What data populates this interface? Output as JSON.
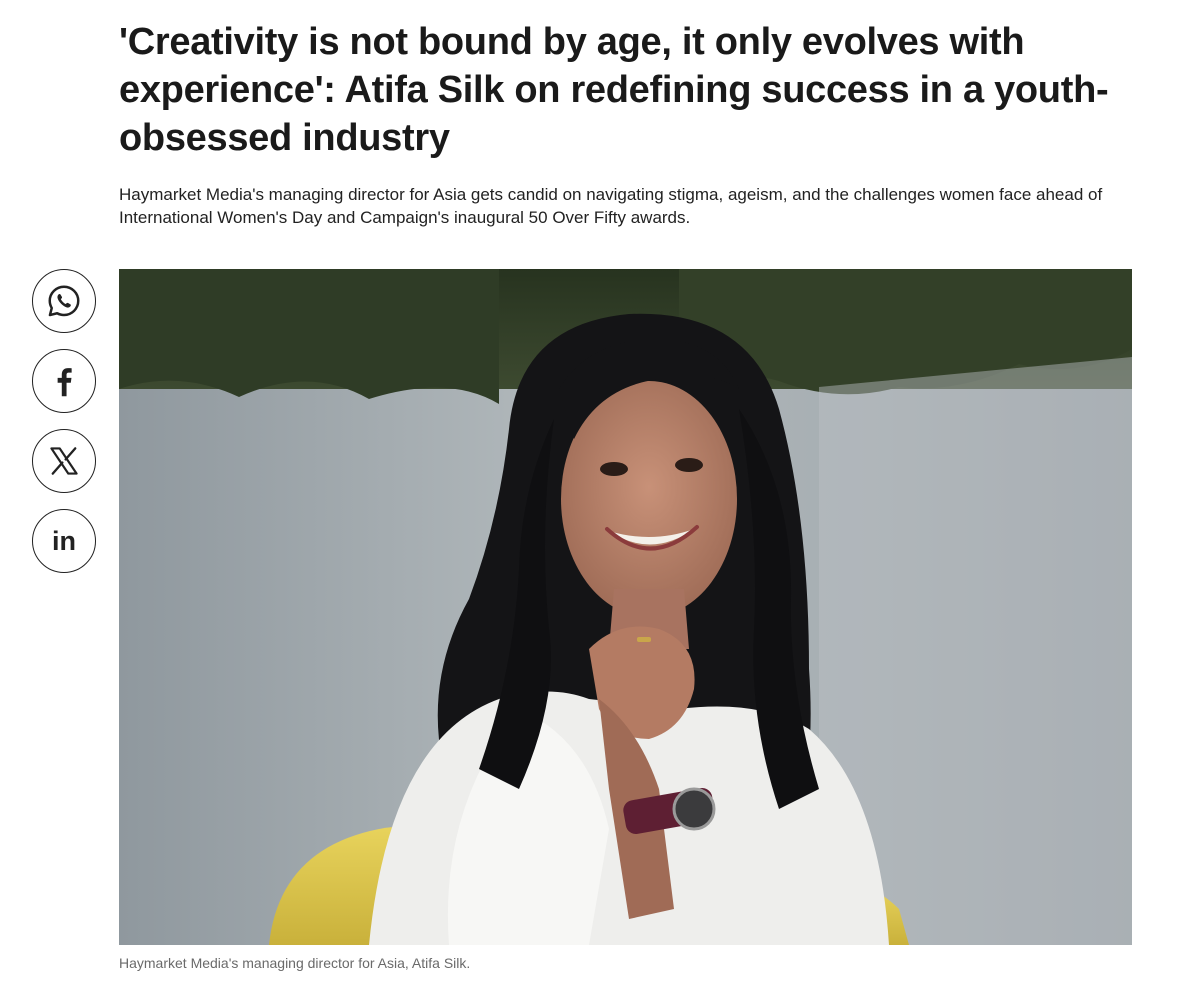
{
  "article": {
    "headline": "'Creativity is not bound by age, it only evolves with experience': Atifa Silk on redefining success in a youth-obsessed industry",
    "standfirst": "Haymarket Media's managing director for Asia gets candid on navigating stigma, ageism, and the challenges women face ahead of International Women's Day and Campaign's inaugural 50 Over Fifty awards.",
    "image_caption": "Haymarket Media's managing director for Asia, Atifa Silk."
  },
  "share": {
    "buttons": [
      {
        "network": "WhatsApp",
        "icon": "whatsapp-icon"
      },
      {
        "network": "Facebook",
        "icon": "facebook-icon"
      },
      {
        "network": "X",
        "icon": "x-icon"
      },
      {
        "network": "LinkedIn",
        "icon": "linkedin-icon",
        "glyph": "in"
      }
    ]
  },
  "theme": {
    "text": "#1a1a1a",
    "caption": "#6a6a6a",
    "icon_stroke": "#222222",
    "background": "#ffffff"
  }
}
